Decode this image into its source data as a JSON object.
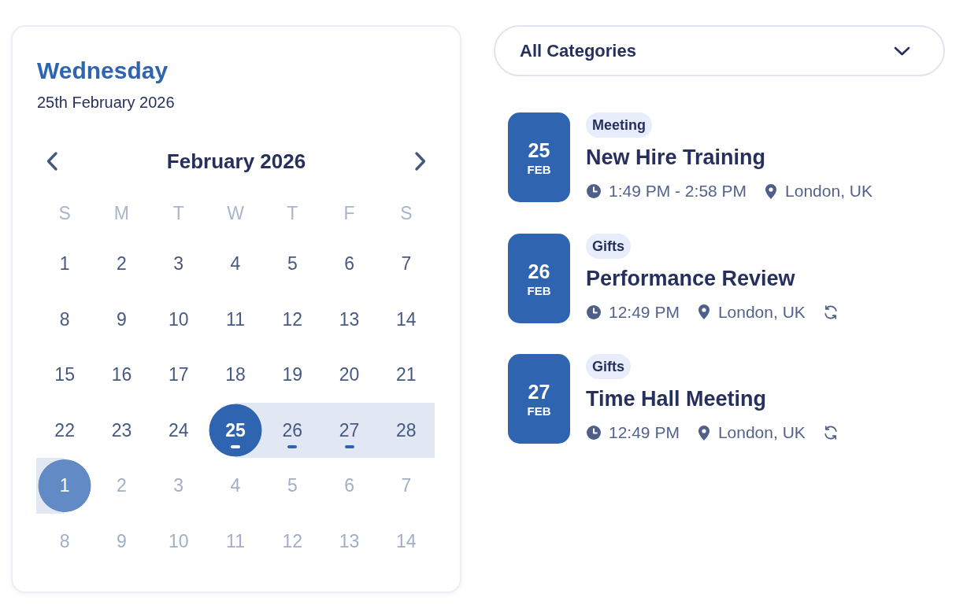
{
  "header": {
    "weekday": "Wednesday",
    "date": "25th February 2026"
  },
  "calendar": {
    "month": "February 2026",
    "weekdays": [
      "S",
      "M",
      "T",
      "W",
      "T",
      "F",
      "S"
    ],
    "weeks": [
      [
        {
          "label": "1",
          "outside_month": false,
          "selected": false,
          "in_range": false,
          "event": false
        },
        {
          "label": "2",
          "outside_month": false,
          "selected": false,
          "in_range": false,
          "event": false
        },
        {
          "label": "3",
          "outside_month": false,
          "selected": false,
          "in_range": false,
          "event": false
        },
        {
          "label": "4",
          "outside_month": false,
          "selected": false,
          "in_range": false,
          "event": false
        },
        {
          "label": "5",
          "outside_month": false,
          "selected": false,
          "in_range": false,
          "event": false
        },
        {
          "label": "6",
          "outside_month": false,
          "selected": false,
          "in_range": false,
          "event": false
        },
        {
          "label": "7",
          "outside_month": false,
          "selected": false,
          "in_range": false,
          "event": false
        }
      ],
      [
        {
          "label": "8",
          "outside_month": false,
          "selected": false,
          "in_range": false,
          "event": false
        },
        {
          "label": "9",
          "outside_month": false,
          "selected": false,
          "in_range": false,
          "event": false
        },
        {
          "label": "10",
          "outside_month": false,
          "selected": false,
          "in_range": false,
          "event": false
        },
        {
          "label": "11",
          "outside_month": false,
          "selected": false,
          "in_range": false,
          "event": false
        },
        {
          "label": "12",
          "outside_month": false,
          "selected": false,
          "in_range": false,
          "event": false
        },
        {
          "label": "13",
          "outside_month": false,
          "selected": false,
          "in_range": false,
          "event": false
        },
        {
          "label": "14",
          "outside_month": false,
          "selected": false,
          "in_range": false,
          "event": false
        }
      ],
      [
        {
          "label": "15",
          "outside_month": false,
          "selected": false,
          "in_range": false,
          "event": false
        },
        {
          "label": "16",
          "outside_month": false,
          "selected": false,
          "in_range": false,
          "event": false
        },
        {
          "label": "17",
          "outside_month": false,
          "selected": false,
          "in_range": false,
          "event": false
        },
        {
          "label": "18",
          "outside_month": false,
          "selected": false,
          "in_range": false,
          "event": false
        },
        {
          "label": "19",
          "outside_month": false,
          "selected": false,
          "in_range": false,
          "event": false
        },
        {
          "label": "20",
          "outside_month": false,
          "selected": false,
          "in_range": false,
          "event": false
        },
        {
          "label": "21",
          "outside_month": false,
          "selected": false,
          "in_range": false,
          "event": false
        }
      ],
      [
        {
          "label": "22",
          "outside_month": false,
          "selected": false,
          "in_range": false,
          "event": false
        },
        {
          "label": "23",
          "outside_month": false,
          "selected": false,
          "in_range": false,
          "event": false
        },
        {
          "label": "24",
          "outside_month": false,
          "selected": false,
          "in_range": false,
          "event": false
        },
        {
          "label": "25",
          "outside_month": false,
          "selected": true,
          "in_range": true,
          "event": true
        },
        {
          "label": "26",
          "outside_month": false,
          "selected": false,
          "in_range": true,
          "event": true
        },
        {
          "label": "27",
          "outside_month": false,
          "selected": false,
          "in_range": true,
          "event": true
        },
        {
          "label": "28",
          "outside_month": false,
          "selected": false,
          "in_range": true,
          "event": false
        }
      ],
      [
        {
          "label": "1",
          "outside_month": true,
          "selected": true,
          "in_range": true,
          "event": false
        },
        {
          "label": "2",
          "outside_month": true,
          "selected": false,
          "in_range": false,
          "event": false
        },
        {
          "label": "3",
          "outside_month": true,
          "selected": false,
          "in_range": false,
          "event": false
        },
        {
          "label": "4",
          "outside_month": true,
          "selected": false,
          "in_range": false,
          "event": false
        },
        {
          "label": "5",
          "outside_month": true,
          "selected": false,
          "in_range": false,
          "event": false
        },
        {
          "label": "6",
          "outside_month": true,
          "selected": false,
          "in_range": false,
          "event": false
        },
        {
          "label": "7",
          "outside_month": true,
          "selected": false,
          "in_range": false,
          "event": false
        }
      ],
      [
        {
          "label": "8",
          "outside_month": true,
          "selected": false,
          "in_range": false,
          "event": false
        },
        {
          "label": "9",
          "outside_month": true,
          "selected": false,
          "in_range": false,
          "event": false
        },
        {
          "label": "10",
          "outside_month": true,
          "selected": false,
          "in_range": false,
          "event": false
        },
        {
          "label": "11",
          "outside_month": true,
          "selected": false,
          "in_range": false,
          "event": false
        },
        {
          "label": "12",
          "outside_month": true,
          "selected": false,
          "in_range": false,
          "event": false
        },
        {
          "label": "13",
          "outside_month": true,
          "selected": false,
          "in_range": false,
          "event": false
        },
        {
          "label": "14",
          "outside_month": true,
          "selected": false,
          "in_range": false,
          "event": false
        }
      ]
    ]
  },
  "filter": {
    "value": "All Categories"
  },
  "events": [
    {
      "day": "25",
      "month": "FEB",
      "category": "Meeting",
      "title": "New Hire Training",
      "time": "1:49 PM - 2:58 PM",
      "location": "London, UK",
      "recurring": false
    },
    {
      "day": "26",
      "month": "FEB",
      "category": "Gifts",
      "title": "Performance Review",
      "time": "12:49 PM",
      "location": "London, UK",
      "recurring": true
    },
    {
      "day": "27",
      "month": "FEB",
      "category": "Gifts",
      "title": "Time Hall Meeting",
      "time": "12:49 PM",
      "location": "London, UK",
      "recurring": true
    }
  ]
}
